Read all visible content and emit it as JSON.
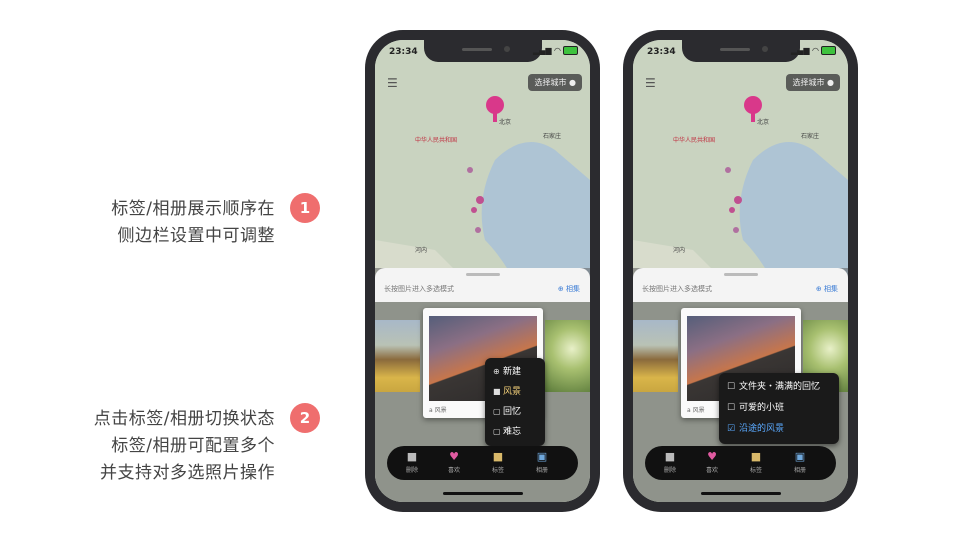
{
  "annotations": {
    "note1": {
      "badge": "1",
      "lines": [
        "标签/相册展示顺序在",
        "侧边栏设置中可调整"
      ]
    },
    "note2": {
      "badge": "2",
      "lines": [
        "点击标签/相册切换状态",
        "标签/相册可配置多个",
        "并支持对多选照片操作"
      ]
    }
  },
  "phone": {
    "time": "23:34",
    "city_button": "选择城市",
    "map_labels": {
      "beijing": "北京",
      "country": "中华人民共和国",
      "shijiazhuang": "石家庄",
      "hanoi": "河内"
    },
    "sheet_hint": "长按图片进入多选模式",
    "album_link": "相集",
    "photo_caption": "a 风景",
    "tabs": [
      {
        "label": "删除",
        "icon": "trash-icon"
      },
      {
        "label": "喜欢",
        "icon": "heart-icon"
      },
      {
        "label": "标签",
        "icon": "tag-icon"
      },
      {
        "label": "相册",
        "icon": "album-icon"
      }
    ]
  },
  "popup_left": {
    "items": [
      {
        "label": "新建",
        "icon": "plus-icon"
      },
      {
        "label": "风景",
        "icon": "tag-icon",
        "selected": true
      },
      {
        "label": "回忆",
        "icon": "tag-icon"
      },
      {
        "label": "难忘",
        "icon": "tag-icon"
      }
    ]
  },
  "popup_right": {
    "items": [
      {
        "label": "文件夹・满满的回忆",
        "checked": false
      },
      {
        "label": "可爱的小班",
        "checked": false
      },
      {
        "label": "沿途的风景",
        "checked": true
      }
    ]
  },
  "colors": {
    "badge": "#ef6e6e",
    "pin": "#d9388a",
    "selected_album": "#5aa9ff",
    "selected_tag": "#f6d27a"
  }
}
